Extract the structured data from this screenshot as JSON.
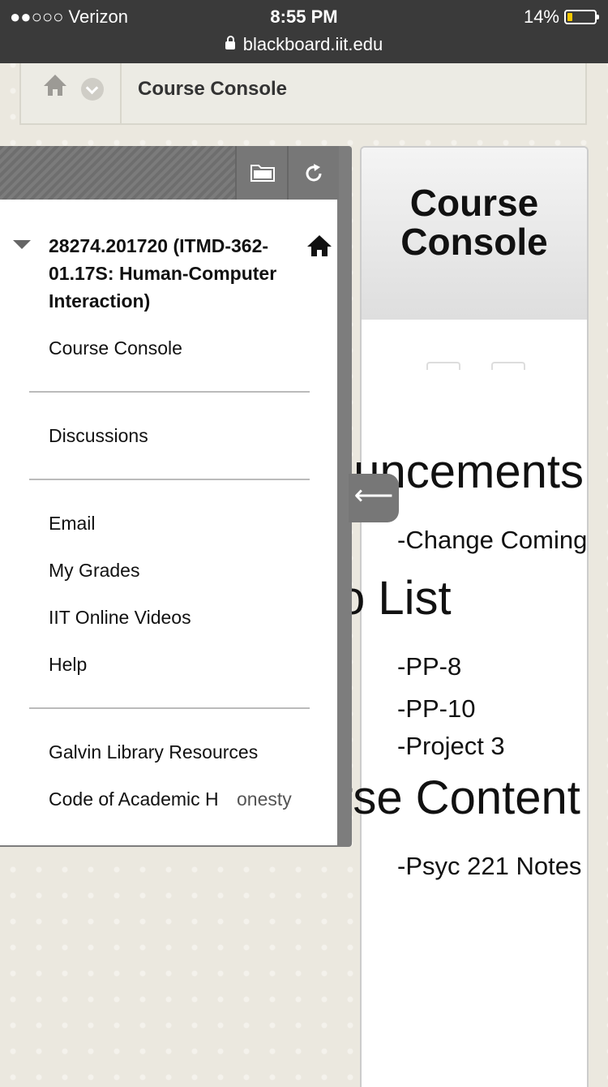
{
  "status_bar": {
    "carrier": "●●○○○ Verizon",
    "time": "8:55 PM",
    "battery": "14%",
    "url": "blackboard.iit.edu"
  },
  "breadcrumb": {
    "title": "Course Console"
  },
  "course_menu": {
    "course_title": "28274.201720 (ITMD-362-01.17S: Human-Computer Interaction)",
    "items": [
      "Course Console",
      "Discussions",
      "Email",
      "My Grades",
      "IIT Online Videos",
      "Help",
      "Galvin Library Resources",
      "Code of Academic H"
    ]
  },
  "toggle_tab": {
    "label": "⟵"
  },
  "content": {
    "header_title": "Course Console",
    "announcements_heading": "ouncements",
    "announcements": [
      "-Change Coming"
    ],
    "todo_heading": "o List",
    "todo": [
      "-PP-8",
      "-PP-10",
      "-Project 3"
    ],
    "overlap_text": "onesty",
    "content_heading": "rse Content",
    "content_items": [
      "-Psyc 221 Notes"
    ]
  },
  "colors": {
    "status_bar": "#3a3a3a",
    "battery_fill": "#f5c800",
    "menu_frame": "#7d7d7d",
    "page_bg": "#ebe8df"
  }
}
